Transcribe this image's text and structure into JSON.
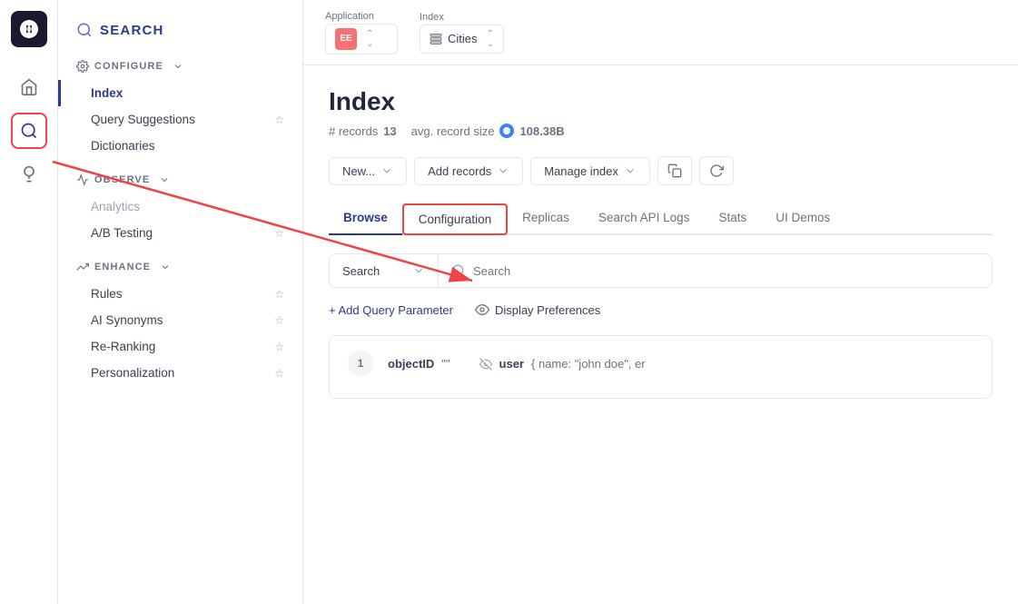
{
  "app": {
    "title": "SEARCH"
  },
  "topbar": {
    "application_label": "Application",
    "index_label": "Index",
    "app_icon": "EE",
    "index_name": "Cities"
  },
  "sidebar": {
    "configure_label": "CONFIGURE",
    "observe_label": "OBSERVE",
    "enhance_label": "ENHANCE",
    "items": {
      "configure": [
        {
          "label": "Index",
          "active": true
        },
        {
          "label": "Query Suggestions",
          "star": true
        },
        {
          "label": "Dictionaries"
        }
      ],
      "observe": [
        {
          "label": "Analytics",
          "disabled": true
        },
        {
          "label": "A/B Testing",
          "star": true
        }
      ],
      "enhance": [
        {
          "label": "Rules",
          "star": true
        },
        {
          "label": "AI Synonyms",
          "star": true
        },
        {
          "label": "Re-Ranking",
          "star": true
        },
        {
          "label": "Personalization",
          "star": true
        }
      ]
    }
  },
  "page": {
    "title": "Index",
    "records_label": "# records",
    "records_count": "13",
    "avg_label": "avg. record size",
    "avg_value": "108.38B"
  },
  "toolbar": {
    "new_label": "New...",
    "add_records_label": "Add records",
    "manage_index_label": "Manage index"
  },
  "tabs": [
    {
      "label": "Browse",
      "active": true
    },
    {
      "label": "Configuration",
      "highlighted": true
    },
    {
      "label": "Replicas"
    },
    {
      "label": "Search API Logs"
    },
    {
      "label": "Stats"
    },
    {
      "label": "UI Demos"
    }
  ],
  "search": {
    "type": "Search",
    "placeholder": "Search"
  },
  "query_bar": {
    "add_param_label": "+ Add Query Parameter",
    "display_pref_label": "Display Preferences"
  },
  "record": {
    "number": "1",
    "object_id_label": "objectID",
    "object_id_value": "\"\"",
    "user_label": "user",
    "user_value": "{ name: \"john doe\", er"
  }
}
